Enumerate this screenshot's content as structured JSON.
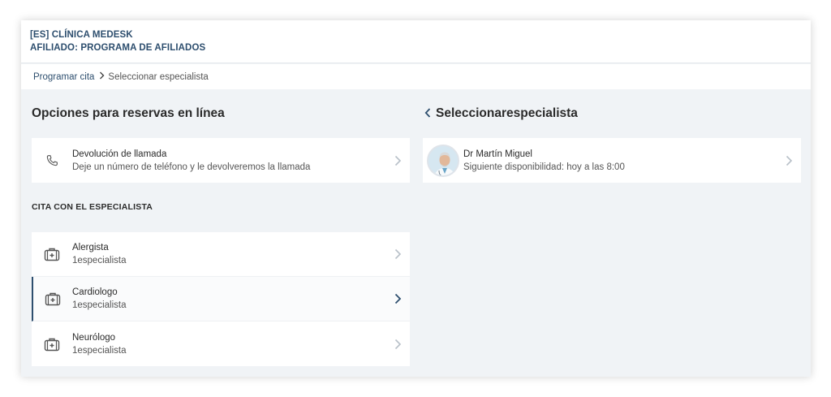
{
  "header": {
    "clinic": "[ES] CLÍNICA MEDESK",
    "program": "AFILIADO: PROGRAMA DE AFILIADOS"
  },
  "breadcrumb": {
    "link": "Programar cita",
    "separator": ">",
    "current": "Seleccionar especialista"
  },
  "left": {
    "title": "Opciones para reservas en línea",
    "callback": {
      "icon": "phone-icon",
      "title": "Devolución de llamada",
      "subtitle": "Deje un número de teléfono y le devolveremos la llamada"
    },
    "section_label": "CITA CON EL ESPECIALISTA",
    "specialties": [
      {
        "name": "Alergista",
        "count": "1especialista",
        "icon": "medical-bag-icon",
        "active": false
      },
      {
        "name": "Cardiologo",
        "count": "1especialista",
        "icon": "medical-bag-icon",
        "active": true
      },
      {
        "name": "Neurólogo",
        "count": "1especialista",
        "icon": "medical-bag-icon",
        "active": false
      }
    ]
  },
  "right": {
    "back_icon": "chevron-left-icon",
    "title": "Seleccionarespecialista",
    "doctor": {
      "name": "Dr Martín Miguel",
      "availability": "Siguiente disponibilidad: hoy a las 8:00"
    }
  },
  "colors": {
    "accent": "#2d4e6e",
    "background": "#f0f3f6",
    "chevron_inactive": "#b8c0c8"
  }
}
